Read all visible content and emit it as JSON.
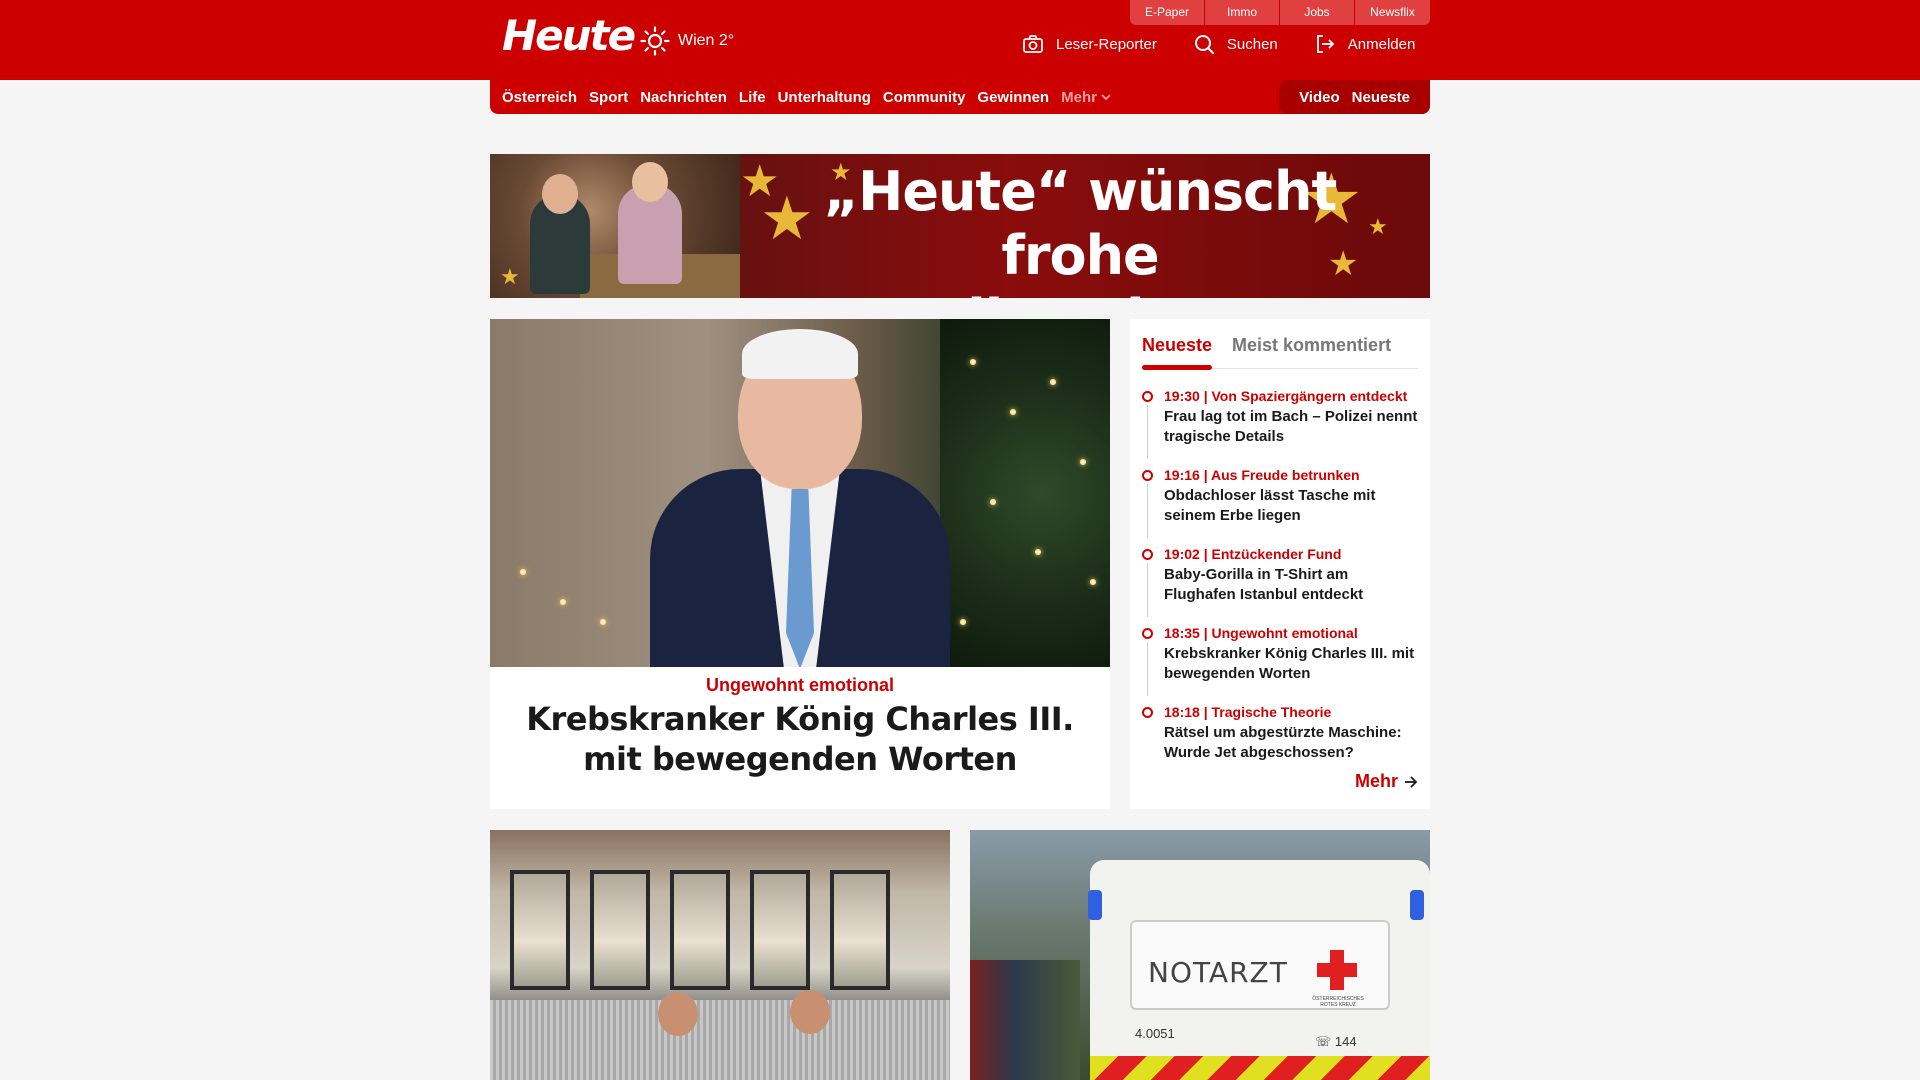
{
  "header": {
    "logo": "Heute",
    "weather": {
      "city_temp": "Wien 2°",
      "icon": "sun-icon"
    },
    "util_links": [
      "E-Paper",
      "Immo",
      "Jobs",
      "Newsflix"
    ],
    "actions": [
      {
        "label": "Leser-Reporter",
        "icon": "camera-icon"
      },
      {
        "label": "Suchen",
        "icon": "search-icon"
      },
      {
        "label": "Anmelden",
        "icon": "login-icon"
      }
    ]
  },
  "nav": {
    "items": [
      "Österreich",
      "Sport",
      "Nachrichten",
      "Life",
      "Unterhaltung",
      "Community",
      "Gewinnen"
    ],
    "more": "Mehr",
    "right": [
      "Video",
      "Neueste"
    ]
  },
  "banner": {
    "line1": "„Heute“ wünscht",
    "line2": "frohe Weihnachten!"
  },
  "feature": {
    "kicker": "Ungewohnt emotional",
    "title": "Krebskranker König Charles III. mit bewegenden Worten"
  },
  "sidebar": {
    "tabs": [
      "Neueste",
      "Meist kommentiert"
    ],
    "active_tab": "Neueste",
    "items": [
      {
        "meta": "19:30 | Von Spaziergängern entdeckt",
        "headline": "Frau lag tot im Bach – Polizei nennt tragische Details"
      },
      {
        "meta": "19:16 | Aus Freude betrunken",
        "headline": "Obdachloser lässt Tasche mit seinem Erbe liegen"
      },
      {
        "meta": "19:02 | Entzückender Fund",
        "headline": "Baby-Gorilla in T-Shirt am Flughafen Istanbul entdeckt"
      },
      {
        "meta": "18:35 | Ungewohnt emotional",
        "headline": "Krebskranker König Charles III. mit bewegenden Worten"
      },
      {
        "meta": "18:18 | Tragische Theorie",
        "headline": "Rätsel um abgestürzte Maschine: Wurde Jet abgeschossen?"
      }
    ],
    "more": "Mehr"
  },
  "cards": {
    "ambulance": {
      "label": "NOTARZT",
      "number": "4.0051",
      "tel": "144",
      "org_line1": "ÖSTERREICHISCHES",
      "org_line2": "ROTES KREUZ"
    }
  },
  "colors": {
    "brand_red": "#cc0000",
    "dark_red": "#a80000",
    "background": "#f5f5f5"
  }
}
